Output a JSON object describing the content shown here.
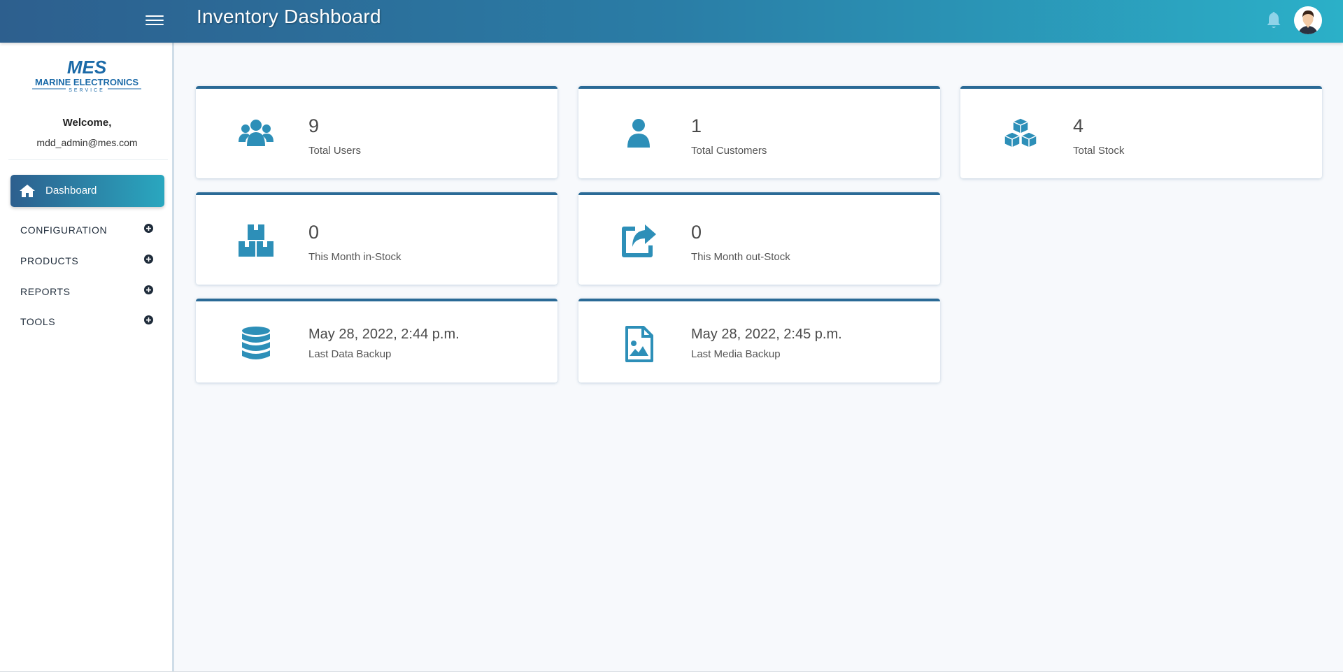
{
  "header": {
    "title": "Inventory Dashboard"
  },
  "sidebar": {
    "logo": {
      "mark": "MES",
      "name": "MARINE ELECTRONICS",
      "tagline": "SERVICE"
    },
    "welcome": "Welcome,",
    "email": "mdd_admin@mes.com",
    "active_item": "Dashboard",
    "items": [
      {
        "label": "CONFIGURATION"
      },
      {
        "label": "PRODUCTS"
      },
      {
        "label": "REPORTS"
      },
      {
        "label": "TOOLS"
      }
    ]
  },
  "cards": [
    {
      "value": "9",
      "label": "Total Users",
      "icon": "users-icon"
    },
    {
      "value": "1",
      "label": "Total Customers",
      "icon": "user-icon"
    },
    {
      "value": "4",
      "label": "Total Stock",
      "icon": "cubes-icon"
    },
    {
      "value": "0",
      "label": "This Month in-Stock",
      "icon": "boxes-icon"
    },
    {
      "value": "0",
      "label": "This Month out-Stock",
      "icon": "share-icon"
    },
    {
      "value": "May 28, 2022, 2:44 p.m.",
      "label": "Last Data Backup",
      "icon": "database-icon"
    },
    {
      "value": "May 28, 2022, 2:45 p.m.",
      "label": "Last Media Backup",
      "icon": "file-image-icon"
    }
  ],
  "colors": {
    "header_start": "#2d5f8e",
    "header_end": "#2bb0c8",
    "icon": "#2d8fb8",
    "card_top_border": "#2a6a96",
    "page_bg": "#f7f9fc"
  }
}
